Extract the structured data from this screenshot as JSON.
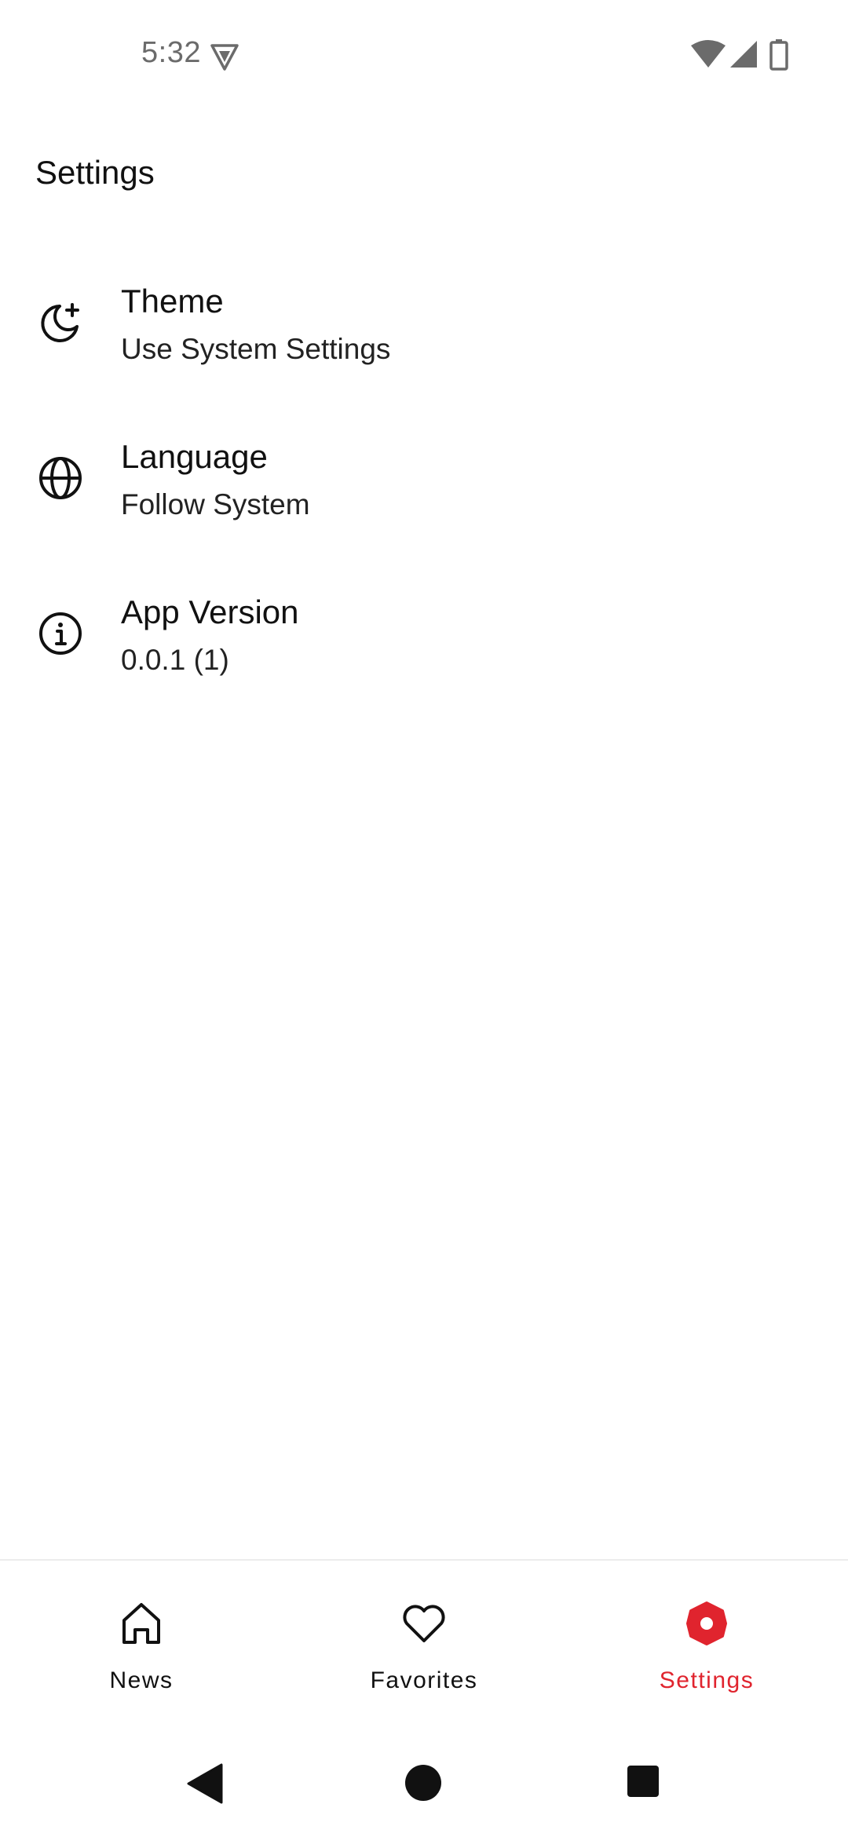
{
  "status_bar": {
    "time": "5:32",
    "icons": [
      "vpn-shield-icon",
      "wifi-icon",
      "cell-signal-icon",
      "battery-icon"
    ]
  },
  "header": {
    "title": "Settings"
  },
  "settings": {
    "items": [
      {
        "icon": "theme-moon-icon",
        "title": "Theme",
        "value": "Use System Settings"
      },
      {
        "icon": "globe-icon",
        "title": "Language",
        "value": "Follow System"
      },
      {
        "icon": "info-icon",
        "title": "App Version",
        "value": "0.0.1 (1)"
      }
    ]
  },
  "bottom_nav": {
    "items": [
      {
        "icon": "home-icon",
        "label": "News",
        "active": false
      },
      {
        "icon": "heart-icon",
        "label": "Favorites",
        "active": false
      },
      {
        "icon": "gear-icon",
        "label": "Settings",
        "active": true
      }
    ]
  },
  "system_nav": {
    "icons": [
      "back-icon",
      "home-circle-icon",
      "recents-icon"
    ]
  },
  "colors": {
    "accent": "#e0242e",
    "text": "#111111",
    "status_text": "#6b6b6b",
    "background": "#ffffff"
  }
}
